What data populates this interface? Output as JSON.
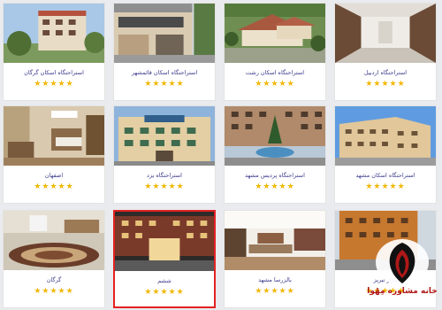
{
  "cards": [
    {
      "title": "استراحتگاه اسکان گرگان",
      "stars": "★★★★★"
    },
    {
      "title": "استراحتگاه اسکان قائمشهر",
      "stars": "★★★★★"
    },
    {
      "title": "استراحتگاه اسکان رشت",
      "stars": "★★★★★"
    },
    {
      "title": "استراحتگاه اردبیل",
      "stars": "★★★★★"
    },
    {
      "title": "اصفهان",
      "stars": "★★★★★"
    },
    {
      "title": "استراحتگاه یزد",
      "stars": "★★★★★"
    },
    {
      "title": "استراحتگاه پردیس مشهد",
      "stars": "★★★★★"
    },
    {
      "title": "استراحتگاه اسکان مشهد",
      "stars": "★★★★★"
    },
    {
      "title": "گرگان",
      "stars": "★★★★★"
    },
    {
      "title": "ششم",
      "stars": "★★★★★"
    },
    {
      "title": "بالزرسا مشهد",
      "stars": "★★★★★"
    },
    {
      "title": "بازار تبریز",
      "stars": "★★★★★"
    }
  ],
  "logo": {
    "text": "خانه مشاوره مِهْوا"
  },
  "colors": {
    "star": "#f2b705",
    "title": "#3a3a8c",
    "selected_border": "#e32222",
    "logo": "#b01818"
  },
  "selected_card": 9
}
